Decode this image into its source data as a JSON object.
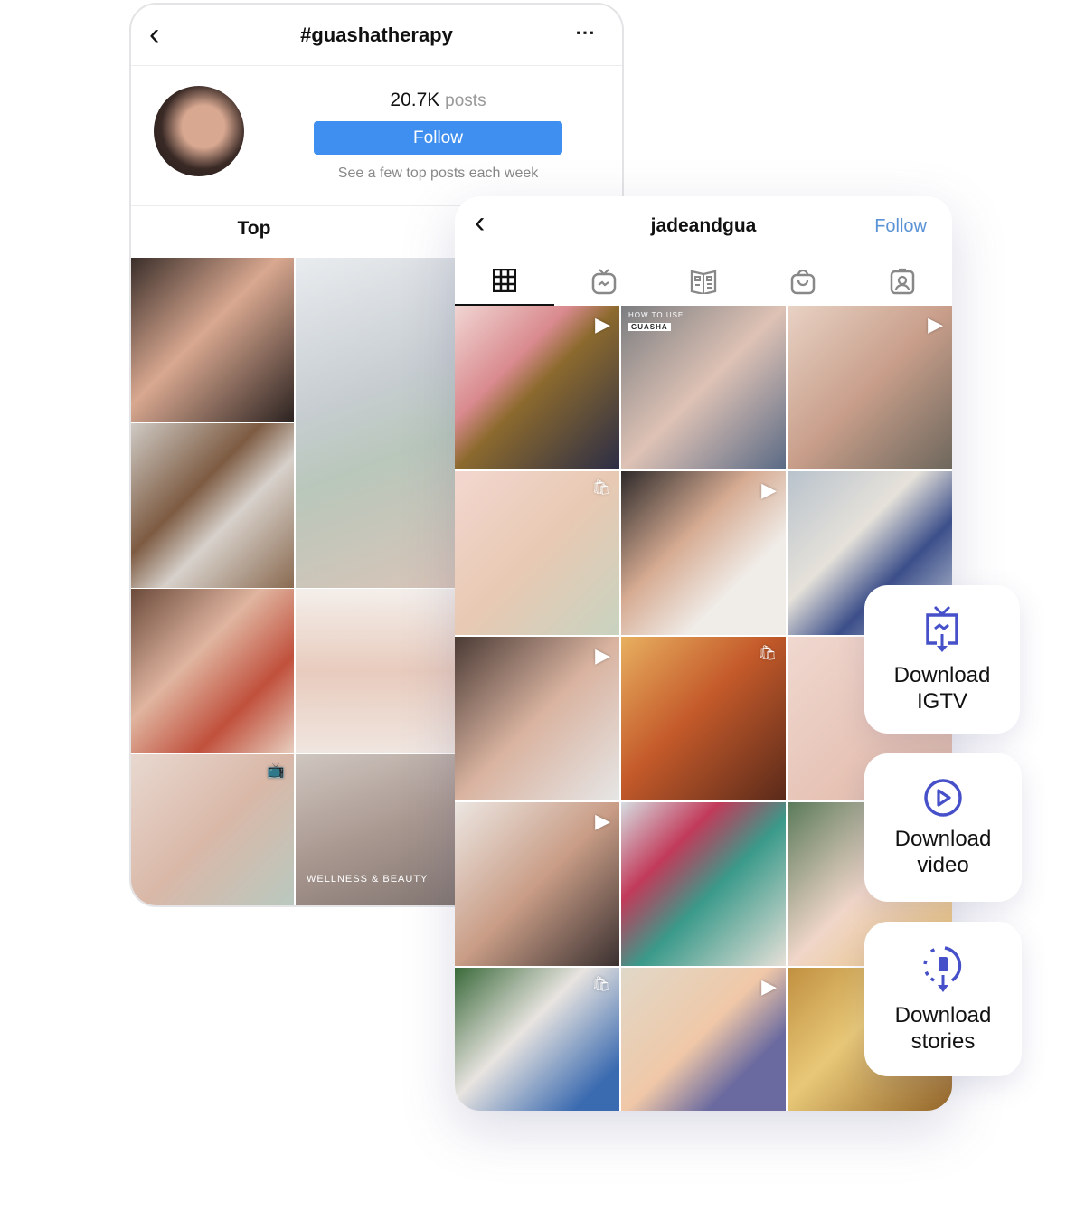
{
  "hashtag_screen": {
    "title": "#guashatherapy",
    "posts_count": "20.7K",
    "posts_label": "posts",
    "follow_label": "Follow",
    "subtitle": "See a few top posts each week",
    "tab_label": "Top",
    "tiles": [
      {
        "bg": "linear-gradient(135deg,#3a2e2a,#d9a890 45%,#2b2220)",
        "badge": ""
      },
      {
        "bg": "linear-gradient(160deg,#e9ecef,#c7cdd1 40%,#b9c7bb 60%,#d8c4b8)",
        "badge": ""
      },
      {
        "bg": "linear-gradient(135deg,#cfcac4,#7d5b42 40%,#d7d1cb 60%,#8a6a50)",
        "badge": ""
      },
      {
        "bg": "linear-gradient(135deg,#6b4a3a,#e0b5a0 40%,#c0503c 70%,#e8cfc0)",
        "badge": ""
      },
      {
        "bg": "linear-gradient(180deg,#f4efeb,#e8cbbd 50%,#f0e6e0)",
        "badge": ""
      },
      {
        "bg": "linear-gradient(135deg,#e8d8cf,#d9b8a8 50%,#b8c9c0)",
        "badge": "igtv"
      },
      {
        "bg": "linear-gradient(160deg,#cfc6c0,#a99890 50%,#7f736e)",
        "badge": ""
      }
    ],
    "tile_captions": {
      "wellness": "WELLNESS & BEAUTY"
    }
  },
  "profile_screen": {
    "username": "jadeandgua",
    "follow_label": "Follow",
    "tabs": [
      {
        "icon": "grid-icon",
        "active": true
      },
      {
        "icon": "igtv-icon"
      },
      {
        "icon": "guides-icon"
      },
      {
        "icon": "shop-icon"
      },
      {
        "icon": "tagged-icon"
      }
    ],
    "tile_captions": {
      "howto": "HOW TO USE",
      "guasha": "GUASHA"
    },
    "tiles": [
      {
        "bg": "linear-gradient(135deg,#f1d6d3,#d98a8e 35%,#8c6a2e 50%,#2b2d45)",
        "badge": "play"
      },
      {
        "bg": "linear-gradient(135deg,#7b7d80,#dec2b5 50%,#5a6a85)",
        "badge": ""
      },
      {
        "bg": "linear-gradient(135deg,#e8d2c4,#c89e8a 50%,#6d675c)",
        "badge": "play"
      },
      {
        "bg": "linear-gradient(135deg,#f3d7cf,#e8c9b3 50%,#c8d3c0)",
        "badge": "shop"
      },
      {
        "bg": "linear-gradient(135deg,#2e2a2a,#d6ab92 40%,#f0ece8 70%)",
        "badge": "play"
      },
      {
        "bg": "linear-gradient(135deg,#b8c2cc,#e6e2da 40%,#3c4f8a 65%,#cfd6de)",
        "badge": ""
      },
      {
        "bg": "linear-gradient(135deg,#4a3a34,#d9b3a0 50%,#e6e6e6)",
        "badge": "play"
      },
      {
        "bg": "linear-gradient(135deg,#e8b060,#c45a2a 45%,#5a2a1a)",
        "badge": "shop"
      },
      {
        "bg": "linear-gradient(135deg,#f0d8d0,#e6c3b5 60%,#d9b8a8)",
        "badge": ""
      },
      {
        "bg": "linear-gradient(135deg,#ece6e2,#c99d86 50%,#3a3030)",
        "badge": "play"
      },
      {
        "bg": "linear-gradient(135deg,#d6dce0,#c23a5a 30%,#3a9a8a 55%,#e6e0d8)",
        "badge": ""
      },
      {
        "bg": "linear-gradient(135deg,#5a7a5a,#f0d6c8 50%,#e8c070)",
        "badge": ""
      },
      {
        "bg": "linear-gradient(135deg,#3a6a3a,#e8e4e0 40%,#3a6ab0 80%)",
        "badge": "shop"
      },
      {
        "bg": "linear-gradient(135deg,#e0d8c8,#f0c8a8 45%,#6a6aa0 70%)",
        "badge": "play"
      },
      {
        "bg": "linear-gradient(135deg,#c09040,#e8c878 40%,#8a5a20)",
        "badge": ""
      }
    ]
  },
  "download_options": [
    {
      "line1": "Download",
      "line2": "IGTV",
      "icon": "igtv-download-icon"
    },
    {
      "line1": "Download",
      "line2": "video",
      "icon": "play-circle-icon"
    },
    {
      "line1": "Download",
      "line2": "stories",
      "icon": "stories-download-icon"
    }
  ],
  "colors": {
    "follow_button": "#3f8ff0",
    "follow_link": "#5b93d6",
    "accent": "#4650c8"
  }
}
